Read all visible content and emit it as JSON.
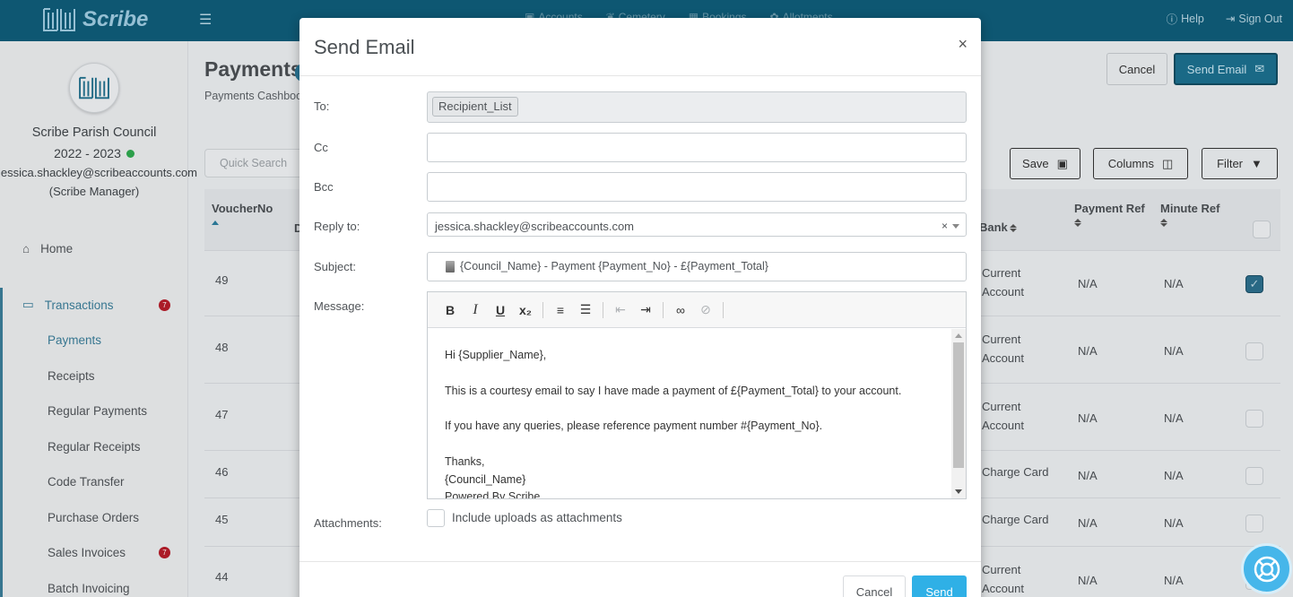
{
  "app": {
    "logo_text": "Scribe",
    "nav": [
      "Accounts",
      "Cemetery",
      "Bookings",
      "Allotments"
    ],
    "help": "Help",
    "sign_out": "Sign Out"
  },
  "sidebar": {
    "council_name": "Scribe Parish Council",
    "year": "2022 - 2023",
    "email": "jessica.shackley@scribeaccounts.com",
    "role": "(Scribe Manager)",
    "home": "Home",
    "transactions": "Transactions",
    "transactions_badge": "7",
    "items": [
      "Payments",
      "Receipts",
      "Regular Payments",
      "Regular Receipts",
      "Code Transfer",
      "Purchase Orders",
      "Sales Invoices",
      "Batch Invoicing"
    ],
    "sales_invoices_badge": "7"
  },
  "page": {
    "title": "Payments",
    "breadcrumb": "Payments Cashbook",
    "cancel_label": "Cancel",
    "send_email_label": "Send Email",
    "quick_search_placeholder": "Quick Search",
    "save_label": "Save",
    "columns_label": "Columns",
    "filter_label": "Filter"
  },
  "table": {
    "headers": {
      "voucher": "VoucherNo",
      "col2_initial": "D",
      "bank": "Bank",
      "payment_ref": "Payment Ref",
      "minute_ref": "Minute Ref"
    },
    "rows": [
      {
        "voucher": "49",
        "bank": [
          "Current",
          "Account"
        ],
        "payment_ref": "N/A",
        "minute_ref": "N/A",
        "checked": true
      },
      {
        "voucher": "48",
        "bank": [
          "Current",
          "Account"
        ],
        "payment_ref": "N/A",
        "minute_ref": "N/A",
        "checked": false
      },
      {
        "voucher": "47",
        "bank": [
          "Current",
          "Account"
        ],
        "payment_ref": "N/A",
        "minute_ref": "N/A",
        "checked": false
      },
      {
        "voucher": "46",
        "bank": [
          "Charge Card"
        ],
        "payment_ref": "N/A",
        "minute_ref": "N/A",
        "checked": false
      },
      {
        "voucher": "45",
        "bank": [
          "Charge Card"
        ],
        "payment_ref": "N/A",
        "minute_ref": "N/A",
        "checked": false
      },
      {
        "voucher": "44",
        "bank": [
          "Current",
          "Account"
        ],
        "payment_ref": "N/A",
        "minute_ref": "N/A",
        "checked": false
      }
    ]
  },
  "modal": {
    "title": "Send Email",
    "close": "×",
    "labels": {
      "to": "To:",
      "cc": "Cc",
      "bcc": "Bcc",
      "reply_to": "Reply to:",
      "subject": "Subject:",
      "message": "Message:",
      "attachments": "Attachments:"
    },
    "to_tag": "Recipient_List",
    "reply_to_value": "jessica.shackley@scribeaccounts.com",
    "subject_value": "{Council_Name} - Payment {Payment_No} - £{Payment_Total}",
    "message_lines": [
      "Hi {Supplier_Name},",
      "",
      "This is a courtesy email to say I have made a payment of £{Payment_Total} to your account.",
      "",
      "If you have any queries, please reference payment number #{Payment_No}.",
      "",
      "Thanks,",
      "{Council_Name}",
      "Powered By Scribe"
    ],
    "attachments_label": "Include uploads as attachments",
    "cancel_label": "Cancel",
    "send_label": "Send"
  },
  "colors": {
    "topbar": "#0f5c79",
    "accent": "#3a7d98",
    "send": "#2fb0e6",
    "badge": "#b51d2a"
  }
}
